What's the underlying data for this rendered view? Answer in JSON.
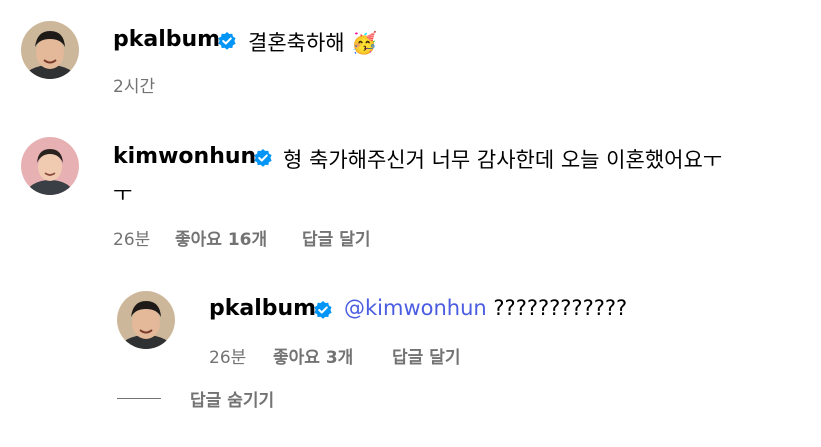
{
  "colors": {
    "text": "#000000",
    "meta": "#737373",
    "mention": "#4a5de0",
    "verified": "#0095f6"
  },
  "comments": [
    {
      "username": "pkalbum",
      "verified_icon": "verified-badge-icon",
      "text": "결혼축하해",
      "emoji": "🥳",
      "time": "2시간"
    },
    {
      "username": "kimwonhun",
      "verified_icon": "verified-badge-icon",
      "text_line1": "형 축가해주신거 너무 감사한데 오늘 이혼했어요ㅜ",
      "text_line2": "ㅜ",
      "time": "26분",
      "likes": "좋아요 16개",
      "reply_label": "답글 달기"
    }
  ],
  "reply": {
    "username": "pkalbum",
    "verified_icon": "verified-badge-icon",
    "mention": "@kimwonhun",
    "text": "????????????",
    "time": "26분",
    "likes": "좋아요 3개",
    "reply_label": "답글 달기"
  },
  "hide_replies_label": "답글 숨기기"
}
